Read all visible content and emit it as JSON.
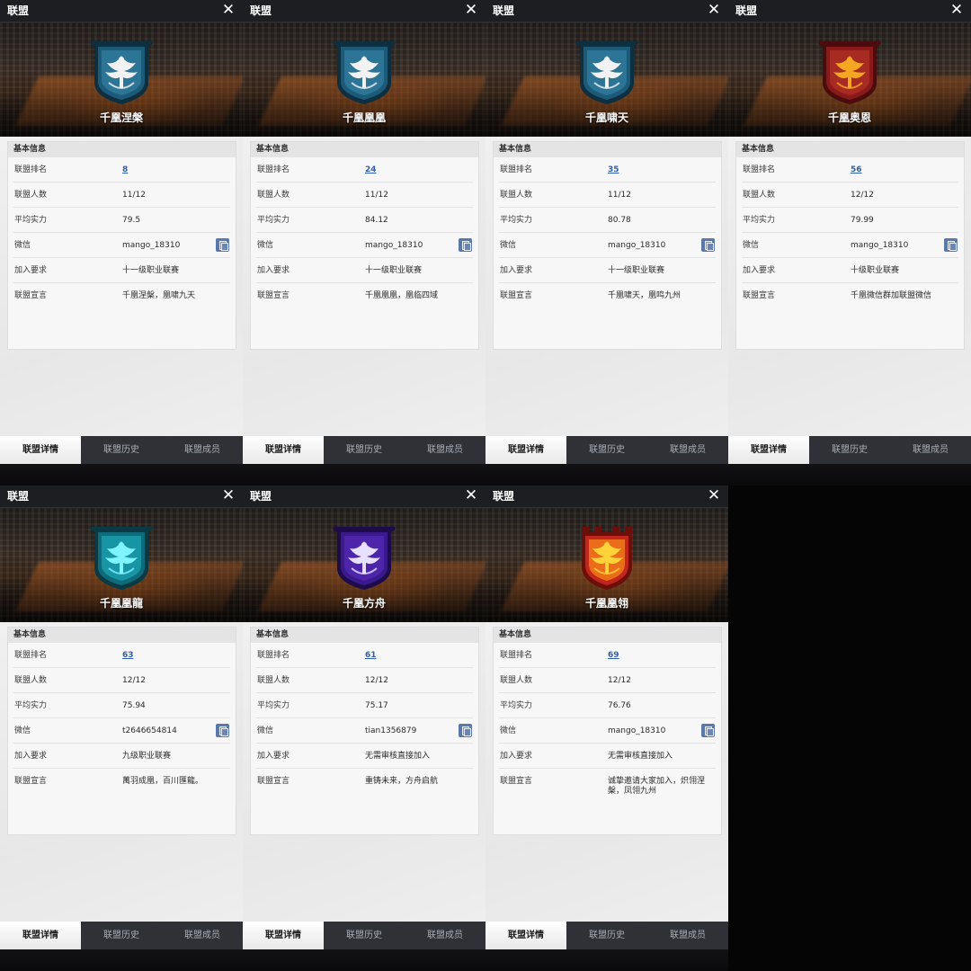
{
  "colors": {
    "header_bg": "#1c1e22",
    "tab_bar_bg": "#2f3136",
    "link_blue": "#2f5fa8",
    "copy_icon_blue": "#5a78a8"
  },
  "panels": [
    {
      "title": "联盟",
      "close_glyph": "✕",
      "name": "千凰涅槃",
      "emblem": {
        "shape": "shield",
        "primary": "#1d5a78",
        "secondary": "#3a8db0",
        "trim": "#0e2f40",
        "bird": "#f2f2f2"
      },
      "section_title": "基本信息",
      "rows": [
        {
          "label": "联盟排名",
          "value": "8"
        },
        {
          "label": "联盟人数",
          "value": "11/12"
        },
        {
          "label": "平均实力",
          "value": "79.5"
        },
        {
          "label": "微信",
          "value": "mango_18310"
        },
        {
          "label": "加入要求",
          "value": "十一级职业联赛"
        },
        {
          "label": "联盟宣言",
          "value": "千凰涅槃，凰啸九天"
        }
      ],
      "tabs": [
        "联盟详情",
        "联盟历史",
        "联盟成员"
      ],
      "active_tab": 0
    },
    {
      "title": "联盟",
      "close_glyph": "✕",
      "name": "千凰凰凰",
      "emblem": {
        "shape": "shield",
        "primary": "#1d5a78",
        "secondary": "#3a8db0",
        "trim": "#0e2f40",
        "bird": "#f2f2f2"
      },
      "section_title": "基本信息",
      "rows": [
        {
          "label": "联盟排名",
          "value": "24"
        },
        {
          "label": "联盟人数",
          "value": "11/12"
        },
        {
          "label": "平均实力",
          "value": "84.12"
        },
        {
          "label": "微信",
          "value": "mango_18310"
        },
        {
          "label": "加入要求",
          "value": "十一级职业联赛"
        },
        {
          "label": "联盟宣言",
          "value": "千凰凰凰，凰临四域"
        }
      ],
      "tabs": [
        "联盟详情",
        "联盟历史",
        "联盟成员"
      ],
      "active_tab": 0
    },
    {
      "title": "联盟",
      "close_glyph": "✕",
      "name": "千凰啸天",
      "emblem": {
        "shape": "shield",
        "primary": "#1d5a78",
        "secondary": "#3a8db0",
        "trim": "#0e2f40",
        "bird": "#f2f2f2"
      },
      "section_title": "基本信息",
      "rows": [
        {
          "label": "联盟排名",
          "value": "35"
        },
        {
          "label": "联盟人数",
          "value": "11/12"
        },
        {
          "label": "平均实力",
          "value": "80.78"
        },
        {
          "label": "微信",
          "value": "mango_18310"
        },
        {
          "label": "加入要求",
          "value": "十一级职业联赛"
        },
        {
          "label": "联盟宣言",
          "value": "千凰啸天，凰鸣九州"
        }
      ],
      "tabs": [
        "联盟详情",
        "联盟历史",
        "联盟成员"
      ],
      "active_tab": 0
    },
    {
      "title": "联盟",
      "close_glyph": "✕",
      "name": "千凰奥恩",
      "emblem": {
        "shape": "shield",
        "primary": "#8a1a1a",
        "secondary": "#c0392b",
        "trim": "#4a0c0c",
        "bird": "#f5a623"
      },
      "section_title": "基本信息",
      "rows": [
        {
          "label": "联盟排名",
          "value": "56"
        },
        {
          "label": "联盟人数",
          "value": "12/12"
        },
        {
          "label": "平均实力",
          "value": "79.99"
        },
        {
          "label": "微信",
          "value": "mango_18310"
        },
        {
          "label": "加入要求",
          "value": "十级职业联赛"
        },
        {
          "label": "联盟宣言",
          "value": "千凰微信群加联盟微信"
        }
      ],
      "tabs": [
        "联盟详情",
        "联盟历史",
        "联盟成员"
      ],
      "active_tab": 0
    },
    {
      "title": "联盟",
      "close_glyph": "✕",
      "name": "千凰凰龍",
      "emblem": {
        "shape": "shield",
        "primary": "#0f6a7a",
        "secondary": "#1fb8c9",
        "trim": "#0a3a44",
        "bird": "#7ff3ff"
      },
      "section_title": "基本信息",
      "rows": [
        {
          "label": "联盟排名",
          "value": "63"
        },
        {
          "label": "联盟人数",
          "value": "12/12"
        },
        {
          "label": "平均实力",
          "value": "75.94"
        },
        {
          "label": "微信",
          "value": "t2646654814"
        },
        {
          "label": "加入要求",
          "value": "九级职业联赛"
        },
        {
          "label": "联盟宣言",
          "value": "萬羽成凰，百川匯龍。"
        }
      ],
      "tabs": [
        "联盟详情",
        "联盟历史",
        "联盟成员"
      ],
      "active_tab": 0
    },
    {
      "title": "联盟",
      "close_glyph": "✕",
      "name": "千凰方舟",
      "emblem": {
        "shape": "shield",
        "primary": "#3a1a8a",
        "secondary": "#5b2fc4",
        "trim": "#1e0c4a",
        "bird": "#e8e0ff"
      },
      "section_title": "基本信息",
      "rows": [
        {
          "label": "联盟排名",
          "value": "61"
        },
        {
          "label": "联盟人数",
          "value": "12/12"
        },
        {
          "label": "平均实力",
          "value": "75.17"
        },
        {
          "label": "微信",
          "value": "tian1356879"
        },
        {
          "label": "加入要求",
          "value": "无需审核直接加入"
        },
        {
          "label": "联盟宣言",
          "value": "重铸未来，方舟启航"
        }
      ],
      "tabs": [
        "联盟详情",
        "联盟历史",
        "联盟成员"
      ],
      "active_tab": 0
    },
    {
      "title": "联盟",
      "close_glyph": "✕",
      "name": "千凰凰翎",
      "emblem": {
        "shape": "tower",
        "primary": "#c0261b",
        "secondary": "#f27a1a",
        "trim": "#6a0f0a",
        "bird": "#ffd23a"
      },
      "section_title": "基本信息",
      "rows": [
        {
          "label": "联盟排名",
          "value": "69"
        },
        {
          "label": "联盟人数",
          "value": "12/12"
        },
        {
          "label": "平均实力",
          "value": "76.76"
        },
        {
          "label": "微信",
          "value": "mango_18310"
        },
        {
          "label": "加入要求",
          "value": "无需审核直接加入"
        },
        {
          "label": "联盟宣言",
          "value": "诚挚邀请大家加入，炽翎涅槃，凤翎九州"
        }
      ],
      "tabs": [
        "联盟详情",
        "联盟历史",
        "联盟成员"
      ],
      "active_tab": 0
    }
  ]
}
